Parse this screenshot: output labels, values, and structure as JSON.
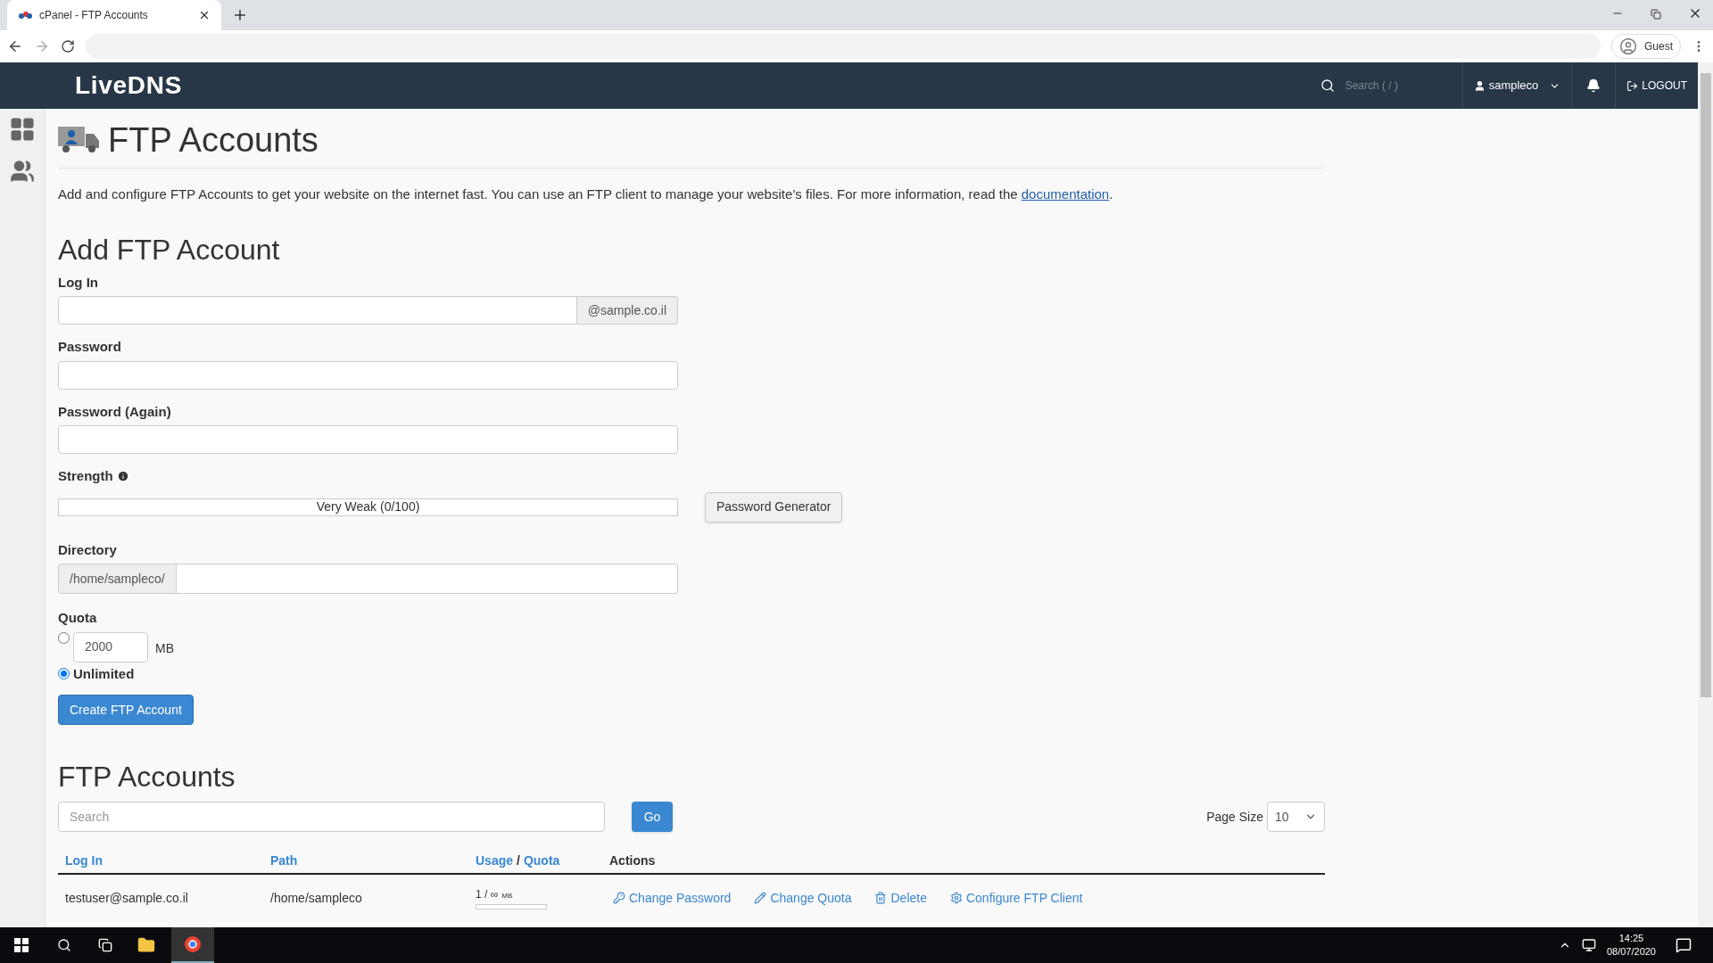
{
  "browser": {
    "tab_title": "cPanel - FTP Accounts",
    "profile": "Guest"
  },
  "header": {
    "logo": "LiveDNS",
    "search_placeholder": "Search ( / )",
    "user": "sampleco",
    "logout": "LOGOUT"
  },
  "page": {
    "title": "FTP Accounts",
    "description_before": "Add and configure FTP Accounts to get your website on the internet fast. You can use an FTP client to manage your website’s files. For more information, read the ",
    "description_link": "documentation",
    "description_after": "."
  },
  "add_form": {
    "heading": "Add FTP Account",
    "login_label": "Log In",
    "login_suffix": "@sample.co.il",
    "password_label": "Password",
    "password_again_label": "Password (Again)",
    "strength_label": "Strength",
    "strength": {
      "level": 0,
      "text": "Very Weak (0/100)"
    },
    "generator_button": "Password Generator",
    "directory_label": "Directory",
    "directory_prefix": "/home/sampleco/",
    "quota_label": "Quota",
    "quota_options": [
      {
        "kind": "limit",
        "value": "2000",
        "unit": "MB",
        "selected": false
      },
      {
        "kind": "unlimited",
        "label": "Unlimited",
        "selected": true
      }
    ],
    "submit": "Create FTP Account"
  },
  "accounts": {
    "heading": "FTP Accounts",
    "search_placeholder": "Search",
    "go": "Go",
    "page_size_label": "Page Size",
    "page_size": "10",
    "columns": [
      {
        "label": "Log In",
        "kind": "sortable"
      },
      {
        "label": "Path",
        "kind": "sortable"
      },
      {
        "kind": "usage",
        "label": "Usage",
        "separator": "/",
        "label2": "Quota"
      },
      {
        "label": "Actions",
        "kind": "plain"
      }
    ],
    "rows": [
      {
        "login": "testuser@sample.co.il",
        "path": "/home/sampleco",
        "usage": "1 / ∞",
        "unit": "MB",
        "actions": [
          {
            "kind": "key",
            "label": "Change Password"
          },
          {
            "kind": "pencil",
            "label": "Change Quota"
          },
          {
            "kind": "trash",
            "label": "Delete"
          },
          {
            "kind": "gear",
            "label": "Configure FTP Client"
          }
        ]
      }
    ]
  },
  "taskbar": {
    "time": "14:25",
    "date": "08/07/2020"
  }
}
